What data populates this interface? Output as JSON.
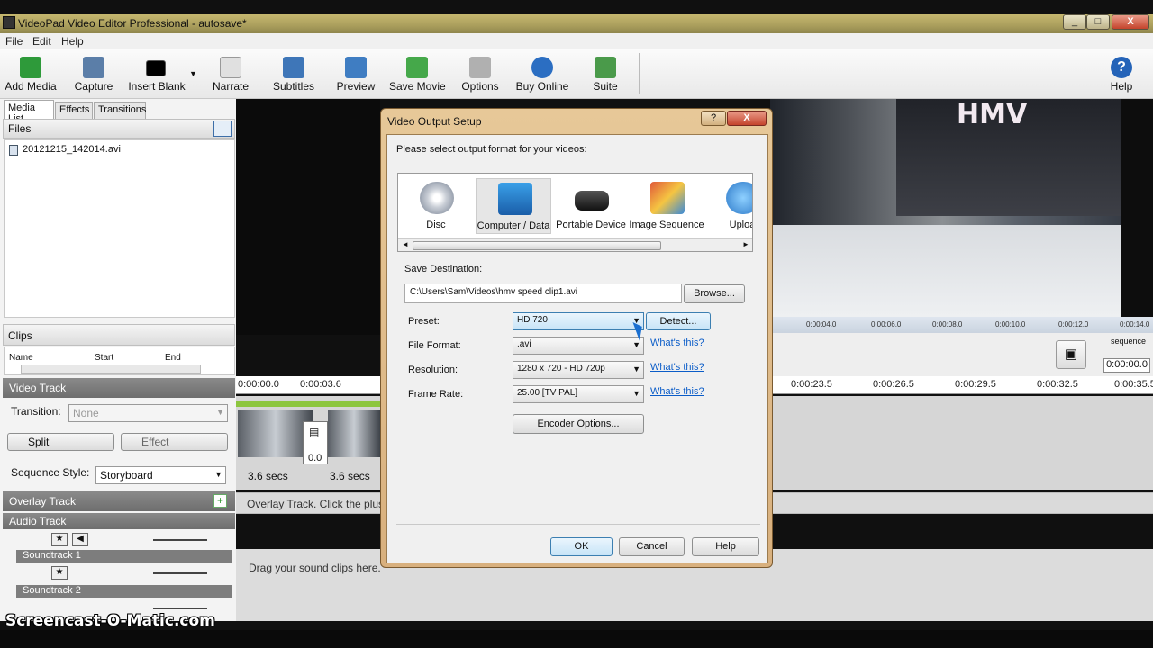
{
  "window": {
    "title": "VideoPad Video Editor Professional - autosave*",
    "controls": [
      "_",
      "□",
      "X"
    ]
  },
  "menu": [
    "File",
    "Edit",
    "Help"
  ],
  "toolbar": {
    "items": [
      {
        "label": "Add Media",
        "icon": "add-media-icon",
        "color": "#2e9a3a"
      },
      {
        "label": "Capture",
        "icon": "camera-icon",
        "color": "#5b7ea8"
      },
      {
        "label": "Insert Blank",
        "icon": "black-frame-icon",
        "color": "#000000"
      },
      {
        "label": "Narrate",
        "icon": "speech-bubble-icon",
        "color": "#d0d0d0"
      },
      {
        "label": "Subtitles",
        "icon": "subtitles-icon",
        "color": "#3e76b8"
      },
      {
        "label": "Preview",
        "icon": "film-preview-icon",
        "color": "#3f7dc2"
      },
      {
        "label": "Save Movie",
        "icon": "save-movie-icon",
        "color": "#45a84a"
      },
      {
        "label": "Options",
        "icon": "options-icon",
        "color": "#b0b0b0"
      },
      {
        "label": "Buy Online",
        "icon": "buy-online-icon",
        "color": "#2b6ec2"
      },
      {
        "label": "Suite",
        "icon": "suite-icon",
        "color": "#4a9a4a"
      }
    ],
    "help_label": "Help"
  },
  "left": {
    "tabs": [
      "Media List",
      "Effects",
      "Transitions"
    ],
    "files_header": "Files",
    "file_name": "20121215_142014.avi",
    "clips_header": "Clips",
    "clips_columns": [
      "Name",
      "Start",
      "End"
    ],
    "video_track": "Video Track",
    "transition_label": "Transition:",
    "transition_value": "None",
    "split_label": "Split",
    "effect_label": "Effect",
    "sequence_style_label": "Sequence Style:",
    "sequence_style_value": "Storyboard",
    "overlay_track": "Overlay Track",
    "audio_track": "Audio Track",
    "soundtrack1": "Soundtrack 1",
    "soundtrack2": "Soundtrack 2"
  },
  "preview": {
    "ruler_ticks": [
      "0:00:04.0",
      "0:00:06.0",
      "0:00:08.0",
      "0:00:10.0",
      "0:00:12.0",
      "0:00:14.0"
    ],
    "sequence_label": "sequence",
    "time": "0:00:00.0",
    "store_sign": "HMV"
  },
  "timeline": {
    "ticks_left": [
      "0:00:00.0",
      "0:00:03.6"
    ],
    "ticks_right": [
      "0:00:23.5",
      "0:00:26.5",
      "0:00:29.5",
      "0:00:32.5",
      "0:00:35.5"
    ],
    "clip1_duration": "3.6 secs",
    "clip2_duration": "3.6 secs",
    "transition_value": "0.0",
    "overlay_hint": "Overlay Track. Click the plus",
    "audio_hint": "Drag your sound clips here."
  },
  "dialog": {
    "title": "Video Output Setup",
    "prompt": "Please select output format for your videos:",
    "formats": [
      {
        "label": "Disc",
        "icon": "disc-icon"
      },
      {
        "label": "Computer / Data",
        "icon": "computer-icon"
      },
      {
        "label": "Portable Device",
        "icon": "psp-icon"
      },
      {
        "label": "Image Sequence",
        "icon": "image-sequence-icon"
      },
      {
        "label": "Uploa",
        "icon": "upload-globe-icon"
      }
    ],
    "save_destination_label": "Save Destination:",
    "save_destination_value": "C:\\Users\\Sam\\Videos\\hmv speed clip1.avi",
    "browse_label": "Browse...",
    "preset_label": "Preset:",
    "preset_value": "HD 720",
    "detect_label": "Detect...",
    "file_format_label": "File Format:",
    "file_format_value": ".avi",
    "resolution_label": "Resolution:",
    "resolution_value": "1280 x 720 - HD 720p",
    "frame_rate_label": "Frame Rate:",
    "frame_rate_value": "25.00 [TV PAL]",
    "whats_this": "What's this?",
    "encoder_label": "Encoder Options...",
    "ok_label": "OK",
    "cancel_label": "Cancel",
    "help_label": "Help",
    "help_btn": "?",
    "close_btn": "X"
  },
  "watermark": "Screencast-O-Matic.com"
}
